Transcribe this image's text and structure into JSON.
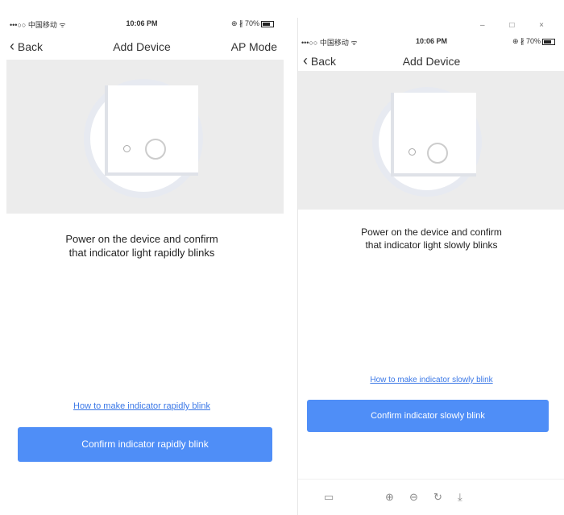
{
  "left": {
    "status": {
      "carrier": "•••○○ 中国移动 ᯤ",
      "time": "10:06 PM",
      "battery": "⊕ ∦ 70%"
    },
    "nav": {
      "back": "Back",
      "title": "Add Device",
      "right": "AP Mode"
    },
    "instruction_line1": "Power on the device and confirm",
    "instruction_line2": "that indicator light rapidly blinks",
    "help_link": "How to make indicator rapidly blink",
    "confirm_button": "Confirm indicator rapidly blink"
  },
  "right": {
    "window_controls": "– □ ×",
    "status": {
      "carrier": "•••○○ 中国移动 ᯤ",
      "time": "10:06 PM",
      "battery": "⊕ ∦ 70%"
    },
    "nav": {
      "back": "Back",
      "title": "Add Device"
    },
    "instruction_line1": "Power on the device and confirm",
    "instruction_line2": "that indicator light slowly blinks",
    "help_link": "How to make indicator slowly blink",
    "confirm_button": "Confirm indicator slowly blink",
    "toolbar_icons": [
      "sidebar-icon",
      "zoom-in-icon",
      "zoom-out-icon",
      "rotate-icon",
      "download-icon"
    ]
  },
  "colors": {
    "accent": "#4f8ef7",
    "link": "#3b78e7",
    "illustration_bg": "#ececec"
  }
}
